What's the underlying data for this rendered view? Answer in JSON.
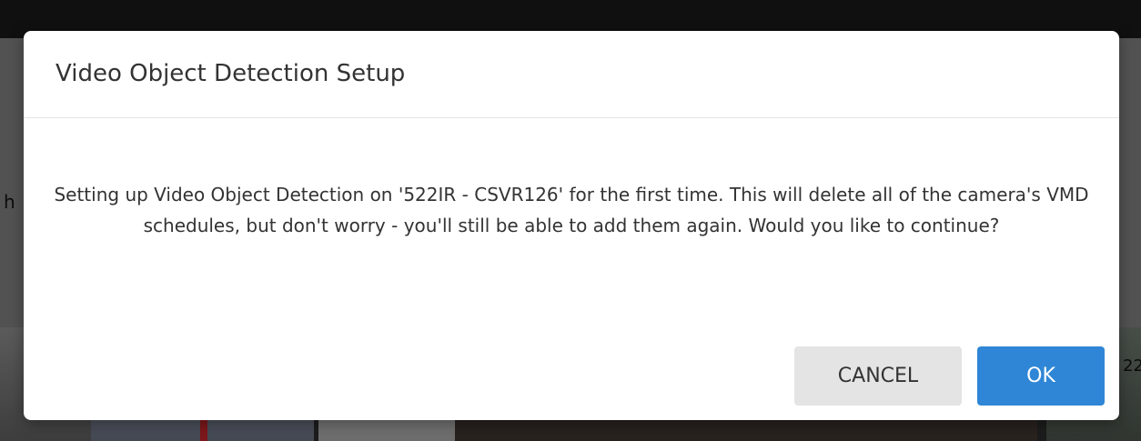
{
  "background": {
    "left_edge_text": "h",
    "right_edge_text": "22"
  },
  "dialog": {
    "title": "Video Object Detection Setup",
    "message": "Setting up Video Object Detection on '522IR - CSVR126' for the first time. This will delete all of the camera's VMD schedules, but don't worry - you'll still be able to add them again. Would you like to continue?",
    "cancel_label": "CANCEL",
    "ok_label": "OK"
  },
  "colors": {
    "accent": "#2f86d6",
    "cancel_bg": "#e4e4e4",
    "text": "#333333"
  }
}
